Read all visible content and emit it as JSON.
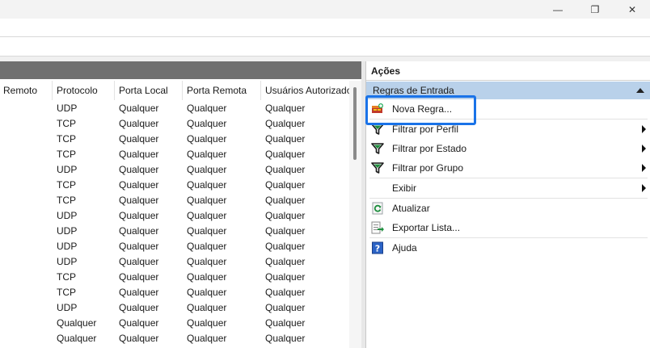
{
  "window": {
    "controls": [
      {
        "name": "minimize-button",
        "icon": "minimize-icon",
        "glyph": "—"
      },
      {
        "name": "maximize-button",
        "icon": "restore-icon",
        "glyph": "❐"
      },
      {
        "name": "close-button",
        "icon": "close-icon",
        "glyph": "✕"
      }
    ]
  },
  "table": {
    "columns": [
      "Remoto",
      "Protocolo",
      "Porta Local",
      "Porta Remota",
      "Usuários Autorizados"
    ],
    "rows": [
      [
        "",
        "UDP",
        "Qualquer",
        "Qualquer",
        "Qualquer"
      ],
      [
        "",
        "TCP",
        "Qualquer",
        "Qualquer",
        "Qualquer"
      ],
      [
        "",
        "TCP",
        "Qualquer",
        "Qualquer",
        "Qualquer"
      ],
      [
        "",
        "TCP",
        "Qualquer",
        "Qualquer",
        "Qualquer"
      ],
      [
        "",
        "UDP",
        "Qualquer",
        "Qualquer",
        "Qualquer"
      ],
      [
        "",
        "TCP",
        "Qualquer",
        "Qualquer",
        "Qualquer"
      ],
      [
        "",
        "TCP",
        "Qualquer",
        "Qualquer",
        "Qualquer"
      ],
      [
        "",
        "UDP",
        "Qualquer",
        "Qualquer",
        "Qualquer"
      ],
      [
        "",
        "UDP",
        "Qualquer",
        "Qualquer",
        "Qualquer"
      ],
      [
        "",
        "UDP",
        "Qualquer",
        "Qualquer",
        "Qualquer"
      ],
      [
        "",
        "UDP",
        "Qualquer",
        "Qualquer",
        "Qualquer"
      ],
      [
        "",
        "TCP",
        "Qualquer",
        "Qualquer",
        "Qualquer"
      ],
      [
        "",
        "TCP",
        "Qualquer",
        "Qualquer",
        "Qualquer"
      ],
      [
        "",
        "UDP",
        "Qualquer",
        "Qualquer",
        "Qualquer"
      ],
      [
        "",
        "Qualquer",
        "Qualquer",
        "Qualquer",
        "Qualquer"
      ],
      [
        "",
        "Qualquer",
        "Qualquer",
        "Qualquer",
        "Qualquer"
      ]
    ]
  },
  "actions": {
    "title": "Ações",
    "section": "Regras de Entrada",
    "items": [
      {
        "name": "nova-regra",
        "label": "Nova Regra...",
        "icon": "new-rule-icon",
        "submenu": false
      },
      {
        "name": "filtrar-por-perfil",
        "label": "Filtrar por Perfil",
        "icon": "filter-icon",
        "submenu": true
      },
      {
        "name": "filtrar-por-estado",
        "label": "Filtrar por Estado",
        "icon": "filter-icon",
        "submenu": true
      },
      {
        "name": "filtrar-por-grupo",
        "label": "Filtrar por Grupo",
        "icon": "filter-icon",
        "submenu": true
      },
      {
        "name": "exibir",
        "label": "Exibir",
        "icon": "",
        "submenu": true
      },
      {
        "name": "atualizar",
        "label": "Atualizar",
        "icon": "refresh-icon",
        "submenu": false
      },
      {
        "name": "exportar-lista",
        "label": "Exportar Lista...",
        "icon": "export-list-icon",
        "submenu": false
      },
      {
        "name": "ajuda",
        "label": "Ajuda",
        "icon": "help-icon",
        "submenu": false
      }
    ]
  },
  "colors": {
    "accent": "#1a73e8",
    "section_header": "#b9d1ea",
    "pane_header": "#707070"
  }
}
